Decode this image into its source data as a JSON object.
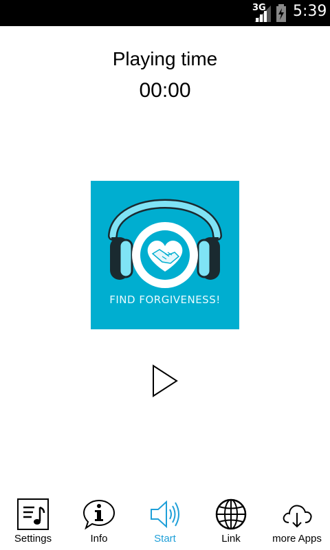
{
  "status_bar": {
    "network": "3G",
    "time": "5:39"
  },
  "player": {
    "title": "Playing time",
    "elapsed": "00:00",
    "cover_text": "FIND FORGIVENESS!"
  },
  "colors": {
    "cover_bg": "#00aed0",
    "accent": "#1e9fd8"
  },
  "nav": {
    "items": [
      {
        "label": "Settings",
        "icon": "settings-music-icon",
        "active": false
      },
      {
        "label": "Info",
        "icon": "info-bubble-icon",
        "active": false
      },
      {
        "label": "Start",
        "icon": "speaker-icon",
        "active": true
      },
      {
        "label": "Link",
        "icon": "globe-icon",
        "active": false
      },
      {
        "label": "more Apps",
        "icon": "cloud-download-icon",
        "active": false
      }
    ]
  }
}
